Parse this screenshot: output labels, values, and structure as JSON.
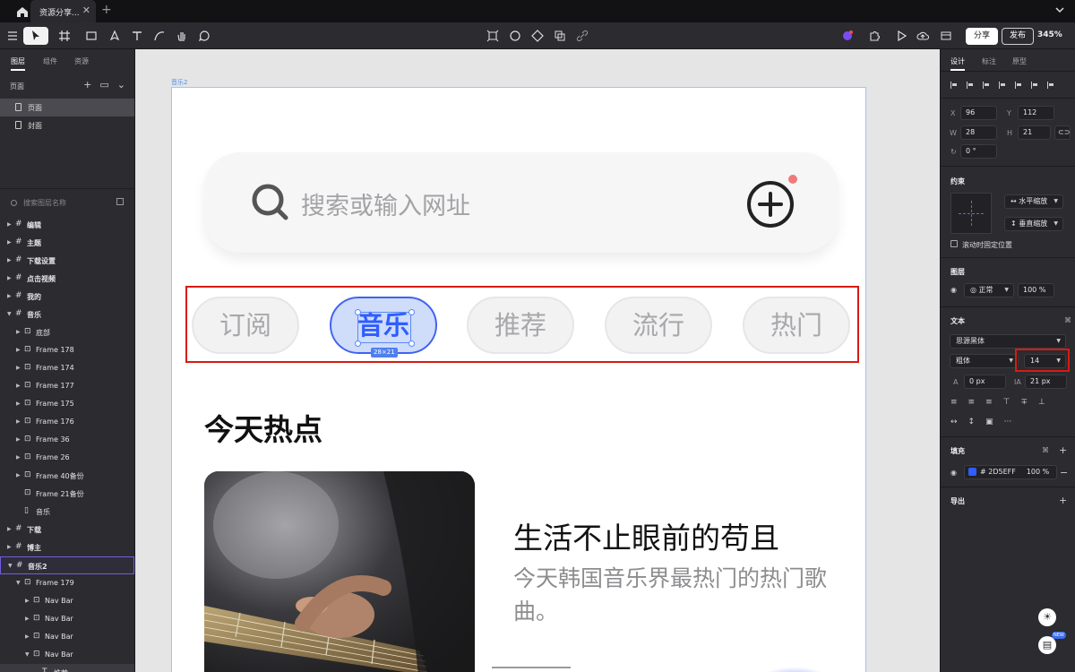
{
  "titlebar": {
    "tab_label": "资源分享...",
    "close": "✕",
    "add": "+"
  },
  "toolbar": {
    "share_label": "分享",
    "publish_label": "发布",
    "zoom": "345%"
  },
  "left_panel": {
    "tabs": [
      "图层",
      "组件",
      "资源"
    ],
    "pages_header": "页面",
    "pages": [
      "页面",
      "封面"
    ],
    "search_placeholder": "搜索图层名称",
    "layers": [
      {
        "label": "编辑",
        "level": 0,
        "icon": "frame"
      },
      {
        "label": "主题",
        "level": 0,
        "icon": "frame"
      },
      {
        "label": "下载设置",
        "level": 0,
        "icon": "frame"
      },
      {
        "label": "点击视频",
        "level": 0,
        "icon": "frame"
      },
      {
        "label": "我的",
        "level": 0,
        "icon": "frame"
      },
      {
        "label": "音乐",
        "level": 0,
        "icon": "frame",
        "open": true
      },
      {
        "label": "底部",
        "level": 1,
        "icon": "group"
      },
      {
        "label": "Frame 178",
        "level": 1,
        "icon": "group"
      },
      {
        "label": "Frame 174",
        "level": 1,
        "icon": "group"
      },
      {
        "label": "Frame 177",
        "level": 1,
        "icon": "group"
      },
      {
        "label": "Frame 175",
        "level": 1,
        "icon": "group"
      },
      {
        "label": "Frame 176",
        "level": 1,
        "icon": "group"
      },
      {
        "label": "Frame 36",
        "level": 1,
        "icon": "group"
      },
      {
        "label": "Frame 26",
        "level": 1,
        "icon": "group"
      },
      {
        "label": "Frame 40备份",
        "level": 1,
        "icon": "group"
      },
      {
        "label": "Frame 21备份",
        "level": 1,
        "icon": "group",
        "nocaret": true
      },
      {
        "label": "音乐",
        "level": 1,
        "icon": "rect",
        "nocaret": true
      },
      {
        "label": "下载",
        "level": 0,
        "icon": "frame"
      },
      {
        "label": "博主",
        "level": 0,
        "icon": "frame"
      },
      {
        "label": "音乐2",
        "level": 0,
        "icon": "frame",
        "open": true,
        "selected": true
      },
      {
        "label": "Frame 179",
        "level": 1,
        "icon": "group",
        "open": true
      },
      {
        "label": "Nav Bar",
        "level": 2,
        "icon": "group"
      },
      {
        "label": "Nav Bar",
        "level": 2,
        "icon": "group"
      },
      {
        "label": "Nav Bar",
        "level": 2,
        "icon": "group"
      },
      {
        "label": "Nav Bar",
        "level": 2,
        "icon": "group",
        "open": true
      },
      {
        "label": "推荐",
        "level": 3,
        "icon": "text",
        "nocaret": true,
        "dim": true
      }
    ]
  },
  "canvas": {
    "frame_label": "音乐2",
    "search_placeholder": "搜索或输入网址",
    "tabs": [
      "订阅",
      "音乐",
      "推荐",
      "流行",
      "热门"
    ],
    "active_tab": "音乐",
    "selection_size": "28×21",
    "section_title": "今天热点",
    "article_title": "生活不止眼前的苟且",
    "article_subtitle": "今天韩国音乐界最热门的热门歌曲。"
  },
  "right_panel": {
    "tabs": [
      "设计",
      "标注",
      "原型"
    ],
    "x_label": "X",
    "x": "96",
    "y_label": "Y",
    "y": "112",
    "w_label": "W",
    "w": "28",
    "h_label": "H",
    "h": "21",
    "rotation": "0 °",
    "constraints_title": "约束",
    "h_constraint": "水平缩放",
    "v_constraint": "垂直缩放",
    "fix_scroll": "滚动时固定位置",
    "layer_title": "图层",
    "blend": "正常",
    "opacity": "100 %",
    "text_title": "文本",
    "font_family": "思源黑体",
    "font_weight": "粗体",
    "font_size": "14",
    "letter_spacing": "0 px",
    "line_height": "21 px",
    "fill_title": "填充",
    "fill_hex": "# 2D5EFF",
    "fill_opacity": "100 %",
    "fill_color": "#2D5EFF",
    "export_title": "导出",
    "new_badge": "NEW"
  }
}
